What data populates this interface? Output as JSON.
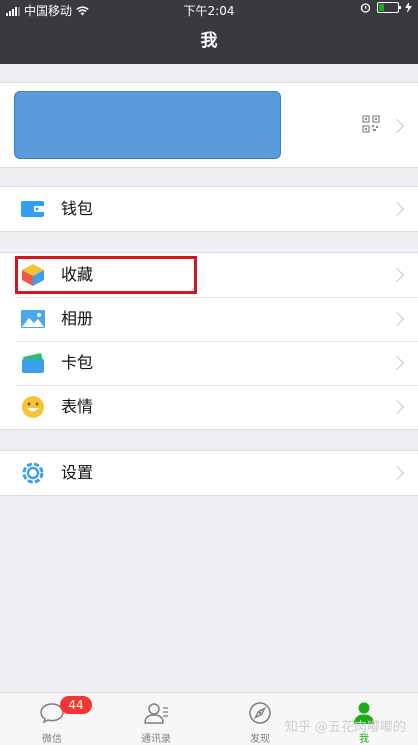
{
  "status_bar": {
    "carrier": "中国移动",
    "time": "下午2:04"
  },
  "header": {
    "title": "我"
  },
  "groups": [
    {
      "items": [
        {
          "label": "钱包",
          "icon": "wallet-icon"
        }
      ]
    },
    {
      "items": [
        {
          "label": "收藏",
          "icon": "favorites-cube-icon"
        },
        {
          "label": "相册",
          "icon": "photo-album-icon"
        },
        {
          "label": "卡包",
          "icon": "card-pack-icon"
        },
        {
          "label": "表情",
          "icon": "emoji-smile-icon"
        }
      ]
    },
    {
      "items": [
        {
          "label": "设置",
          "icon": "settings-gear-icon"
        }
      ]
    }
  ],
  "tab_bar": {
    "tabs": [
      {
        "label": "微信",
        "icon": "chat-bubble-icon",
        "badge": "44"
      },
      {
        "label": "通讯录",
        "icon": "contacts-icon"
      },
      {
        "label": "发现",
        "icon": "compass-icon"
      },
      {
        "label": "我",
        "icon": "person-icon",
        "active": true
      }
    ]
  },
  "watermark": "知乎 @五花肉嘟嘟的",
  "colors": {
    "nav": "#393a3f",
    "accent": "#1aad19",
    "highlight": "#d4141c",
    "badge": "#f43530"
  }
}
